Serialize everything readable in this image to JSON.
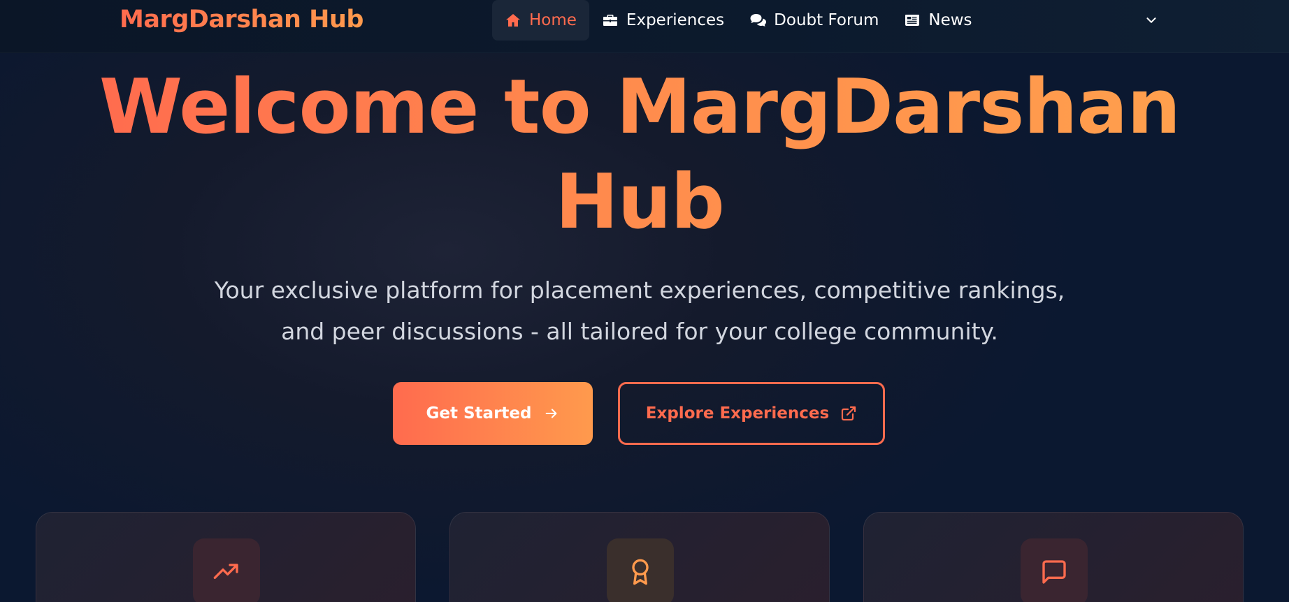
{
  "brand": {
    "name": "MargDarshan Hub"
  },
  "nav": {
    "items": [
      {
        "label": "Home",
        "icon": "home-icon",
        "active": true
      },
      {
        "label": "Experiences",
        "icon": "briefcase-icon",
        "active": false
      },
      {
        "label": "Doubt Forum",
        "icon": "comments-icon",
        "active": false
      },
      {
        "label": "News",
        "icon": "newspaper-icon",
        "active": false
      }
    ],
    "dropdown_icon": "chevron-down-icon"
  },
  "hero": {
    "title": "Welcome to MargDarshan Hub",
    "subtitle": "Your exclusive platform for placement experiences, competitive rankings, and peer discussions - all tailored for your college community.",
    "primary_button": "Get Started",
    "secondary_button": "Explore Experiences"
  },
  "features": [
    {
      "icon": "trending-up-icon"
    },
    {
      "icon": "award-icon"
    },
    {
      "icon": "message-square-icon"
    }
  ],
  "colors": {
    "accent": "#ff6b4e",
    "accent_end": "#ff9a4d",
    "background": "#0b1830",
    "nav_active_bg": "#1a2638"
  }
}
